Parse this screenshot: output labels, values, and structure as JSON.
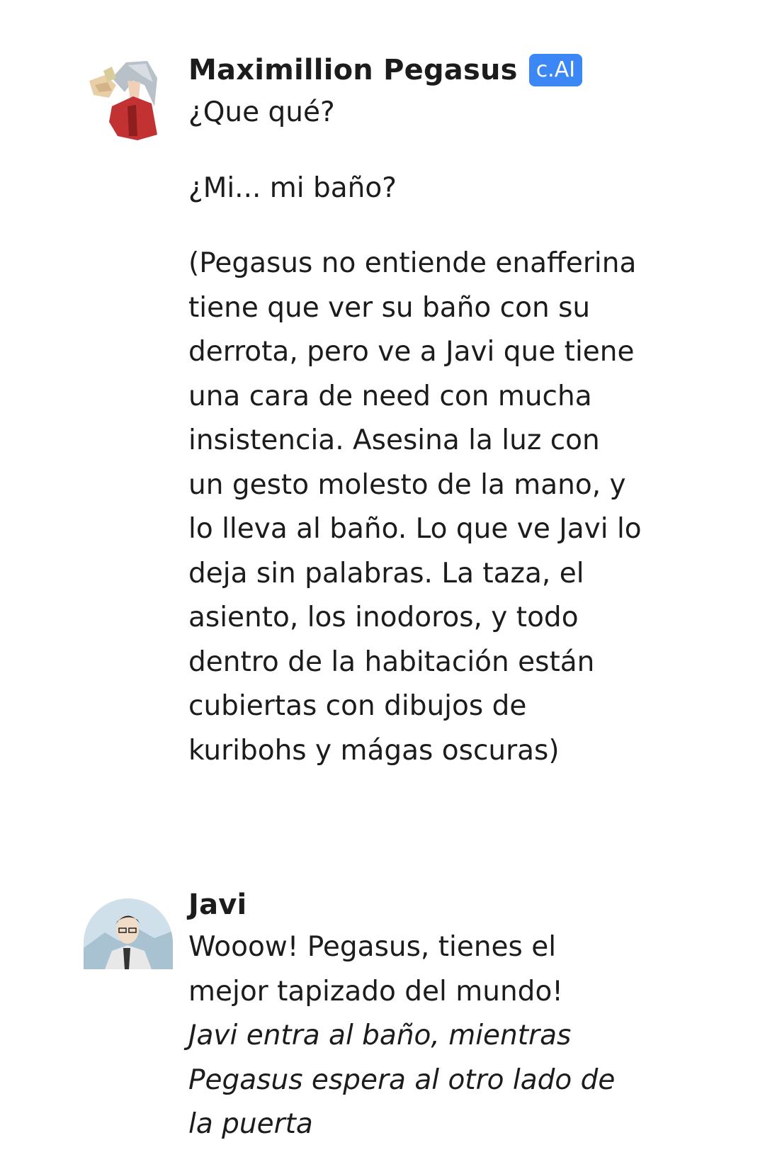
{
  "messages": [
    {
      "author": "Maximillion Pegasus",
      "badge": "c.AI",
      "paragraphs": [
        "¿Que qué?",
        "¿Mi... mi baño?",
        "(Pegasus no entiende enafferina tiene que ver su baño con su derrota, pero ve a Javi que tiene una cara de need con mucha insistencia. Asesina la luz con un gesto molesto de la mano, y lo lleva al baño. Lo que ve Javi lo deja sin palabras. La taza, el asiento, los inodoros, y todo dentro de la habitación están cubiertas con dibujos de kuribohs y mágas oscuras)"
      ]
    },
    {
      "author": "Javi",
      "text": "Wooow! Pegasus, tienes el mejor tapizado del mundo!",
      "action": "Javi entra al baño, mientras Pegasus espera al otro lado de la puerta"
    }
  ],
  "colors": {
    "badge": "#3a87f5",
    "text": "#1c1c1c"
  }
}
